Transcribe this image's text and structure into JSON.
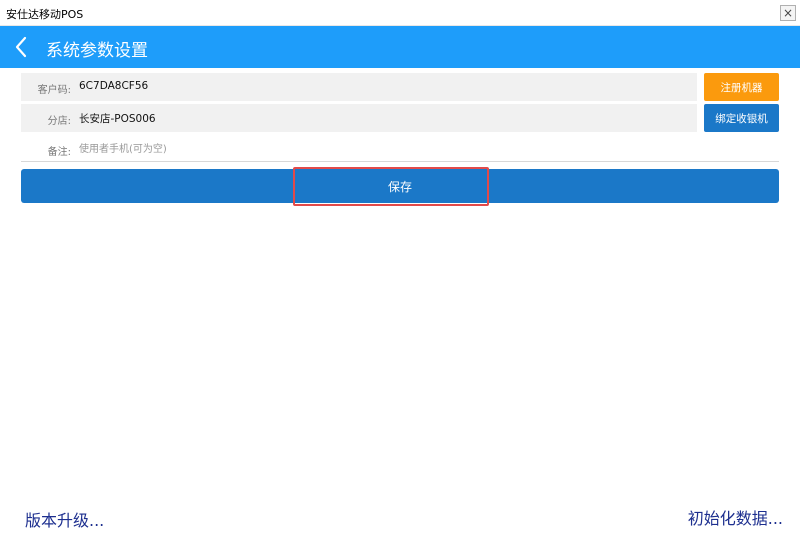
{
  "window": {
    "title": "安仕达移动POS",
    "close_glyph": "×"
  },
  "header": {
    "back_icon": "chevron-left-icon",
    "title": "系统参数设置"
  },
  "form": {
    "customer_code": {
      "label": "客户码:",
      "value": "6C7DA8CF56"
    },
    "branch": {
      "label": "分店:",
      "value": "长安店-POS006"
    },
    "note": {
      "label": "备注:",
      "value": "",
      "placeholder": "使用者手机(可为空)"
    }
  },
  "buttons": {
    "register": "注册机器",
    "bind": "绑定收银机",
    "save": "保存"
  },
  "footer": {
    "upgrade": "版本升级...",
    "init": "初始化数据..."
  },
  "colors": {
    "header": "#1e9dfa",
    "register_button": "#fb9a0d",
    "primary_button": "#1b78c8",
    "highlight": "#e24a4a",
    "link": "#1d2f8f"
  }
}
